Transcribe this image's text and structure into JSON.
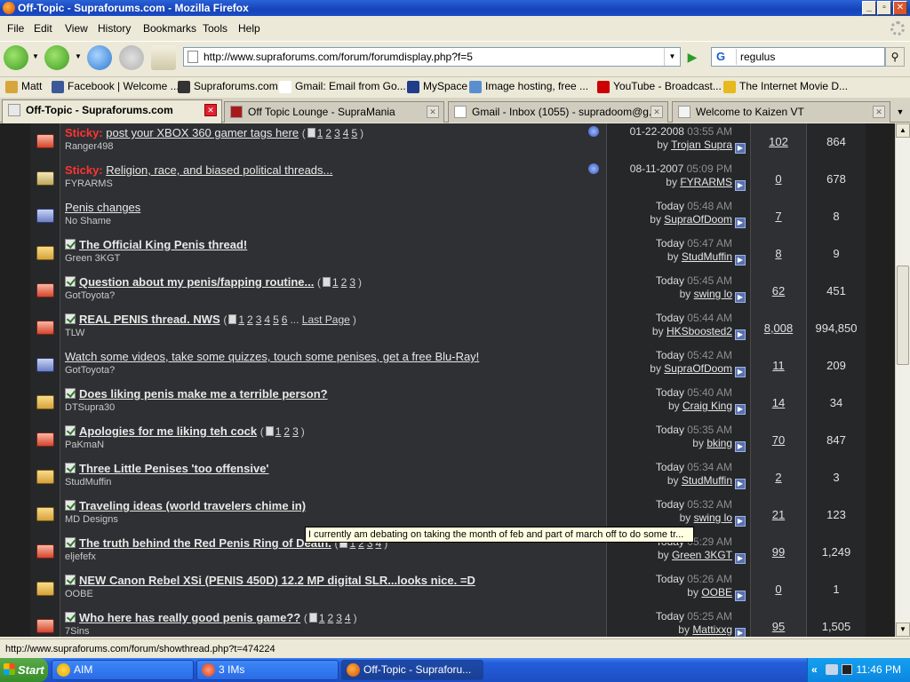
{
  "window": {
    "title": "Off-Topic - Supraforums.com - Mozilla Firefox"
  },
  "menu": [
    "File",
    "Edit",
    "View",
    "History",
    "Bookmarks",
    "Tools",
    "Help"
  ],
  "nav": {
    "url": "http://www.supraforums.com/forum/forumdisplay.php?f=5",
    "search_value": "regulus",
    "search_engine": "G"
  },
  "bookmarks": [
    {
      "label": "Matt",
      "color": "#d7a63a"
    },
    {
      "label": "Facebook | Welcome ...",
      "color": "#3b5998"
    },
    {
      "label": "Supraforums.com",
      "color": "#333333"
    },
    {
      "label": "Gmail: Email from Go...",
      "color": "#ffffff"
    },
    {
      "label": "MySpace",
      "color": "#1f3d8a"
    },
    {
      "label": "Image hosting, free ...",
      "color": "#5a8fcf"
    },
    {
      "label": "YouTube - Broadcast...",
      "color": "#cc0000"
    },
    {
      "label": "The Internet Movie D...",
      "color": "#e6b91e"
    }
  ],
  "tabs": [
    {
      "label": "Off-Topic - Supraforums.com",
      "active": true
    },
    {
      "label": "Off Topic Lounge - SupraMania",
      "active": false
    },
    {
      "label": "Gmail - Inbox (1055) - supradoom@g...",
      "active": false
    },
    {
      "label": "Welcome to Kaizen VT",
      "active": false
    }
  ],
  "threads": [
    {
      "icon": "red",
      "sticky": "Sticky:",
      "title": "post your XBOX 360 gamer tags here",
      "bold": false,
      "check": false,
      "pages": [
        "1",
        "2",
        "3",
        "4",
        "5"
      ],
      "last_page": "",
      "author": "Ranger498",
      "pin": true,
      "date": "01-22-2008",
      "time": "03:55 AM",
      "by": "Trojan Supra",
      "replies": "102",
      "views": "864"
    },
    {
      "icon": "lock",
      "sticky": "Sticky:",
      "title": "Religion, race, and biased political threads...",
      "bold": false,
      "check": false,
      "pages": [],
      "last_page": "",
      "author": "FYRARMS",
      "pin": true,
      "date": "08-11-2007",
      "time": "05:09 PM",
      "by": "FYRARMS",
      "replies": "0",
      "views": "678"
    },
    {
      "icon": "blu",
      "sticky": "",
      "title": "Penis changes",
      "bold": false,
      "check": false,
      "pages": [],
      "last_page": "",
      "author": "No Shame",
      "pin": false,
      "date": "Today",
      "time": "05:48 AM",
      "by": "SupraOfDoom",
      "replies": "7",
      "views": "8"
    },
    {
      "icon": "yel",
      "sticky": "",
      "title": "The Official King Penis thread!",
      "bold": true,
      "check": true,
      "pages": [],
      "last_page": "",
      "author": "Green 3KGT",
      "pin": false,
      "date": "Today",
      "time": "05:47 AM",
      "by": "StudMuffin",
      "replies": "8",
      "views": "9"
    },
    {
      "icon": "red",
      "sticky": "",
      "title": "Question about my penis/fapping routine...",
      "bold": true,
      "check": true,
      "pages": [
        "1",
        "2",
        "3"
      ],
      "last_page": "",
      "author": "GotToyota?",
      "pin": false,
      "date": "Today",
      "time": "05:45 AM",
      "by": "swing lo",
      "replies": "62",
      "views": "451"
    },
    {
      "icon": "red",
      "sticky": "",
      "title": "REAL PENIS thread. NWS",
      "bold": true,
      "check": true,
      "pages": [
        "1",
        "2",
        "3",
        "4",
        "5",
        "6"
      ],
      "last_page": "Last Page",
      "author": "TLW",
      "pin": false,
      "date": "Today",
      "time": "05:44 AM",
      "by": "HKSboosted2",
      "replies": "8,008",
      "views": "994,850"
    },
    {
      "icon": "blu",
      "sticky": "",
      "title": "Watch some videos, take some quizzes, touch some penises, get a free Blu-Ray!",
      "bold": false,
      "check": false,
      "pages": [],
      "last_page": "",
      "author": "GotToyota?",
      "pin": false,
      "date": "Today",
      "time": "05:42 AM",
      "by": "SupraOfDoom",
      "replies": "11",
      "views": "209"
    },
    {
      "icon": "yel",
      "sticky": "",
      "title": "Does liking penis make me a terrible person?",
      "bold": true,
      "check": true,
      "pages": [],
      "last_page": "",
      "author": "DTSupra30",
      "pin": false,
      "date": "Today",
      "time": "05:40 AM",
      "by": "Craig King",
      "replies": "14",
      "views": "34"
    },
    {
      "icon": "red",
      "sticky": "",
      "title": "Apologies for me liking teh cock",
      "bold": true,
      "check": true,
      "pages": [
        "1",
        "2",
        "3"
      ],
      "last_page": "",
      "author": "PaKmaN",
      "pin": false,
      "date": "Today",
      "time": "05:35 AM",
      "by": "bking",
      "replies": "70",
      "views": "847"
    },
    {
      "icon": "yel",
      "sticky": "",
      "title": "Three Little Penises 'too offensive'",
      "bold": true,
      "check": true,
      "pages": [],
      "last_page": "",
      "author": "StudMuffin",
      "pin": false,
      "date": "Today",
      "time": "05:34 AM",
      "by": "StudMuffin",
      "replies": "2",
      "views": "3"
    },
    {
      "icon": "yel",
      "sticky": "",
      "title": "Traveling ideas (world travelers chime in)",
      "bold": true,
      "check": true,
      "pages": [],
      "last_page": "",
      "author": "MD Designs",
      "pin": false,
      "date": "Today",
      "time": "05:32 AM",
      "by": "swing lo",
      "replies": "21",
      "views": "123"
    },
    {
      "icon": "red",
      "sticky": "",
      "title": "The truth behind the Red Penis Ring of Death.",
      "bold": true,
      "check": true,
      "pages": [
        "1",
        "2",
        "3",
        "4"
      ],
      "last_page": "",
      "author": "eljefefx",
      "pin": false,
      "date": "Today",
      "time": "05:29 AM",
      "by": "Green 3KGT",
      "replies": "99",
      "views": "1,249"
    },
    {
      "icon": "yel",
      "sticky": "",
      "title": "NEW Canon Rebel XSi (PENIS 450D) 12.2 MP digital SLR...looks nice. =D",
      "bold": true,
      "check": true,
      "pages": [],
      "last_page": "",
      "author": "OOBE",
      "pin": false,
      "date": "Today",
      "time": "05:26 AM",
      "by": "OOBE",
      "replies": "0",
      "views": "1"
    },
    {
      "icon": "red",
      "sticky": "",
      "title": "Who here has really good penis game??",
      "bold": true,
      "check": true,
      "pages": [
        "1",
        "2",
        "3",
        "4"
      ],
      "last_page": "",
      "author": "7Sins",
      "pin": false,
      "date": "Today",
      "time": "05:25 AM",
      "by": "Mattixxg",
      "replies": "95",
      "views": "1,505"
    }
  ],
  "by_prefix": "by",
  "tooltip": "I currently am debating on taking the month of feb and part of march off to do some tr...",
  "status": "http://www.supraforums.com/forum/showthread.php?t=474224",
  "taskbar": {
    "start": "Start",
    "items": [
      {
        "label": "AIM",
        "active": false
      },
      {
        "label": "3 IMs",
        "active": false
      },
      {
        "label": "Off-Topic - Supraforu...",
        "active": true
      }
    ],
    "clock": "11:46 PM",
    "chevron": "«"
  }
}
